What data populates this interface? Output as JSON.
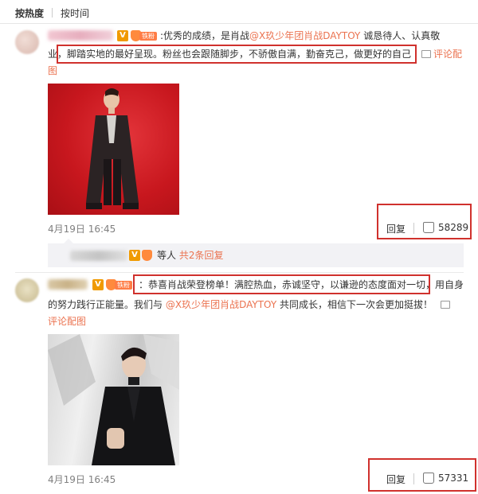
{
  "sort_tabs": {
    "active": "按热度",
    "other": "按时间"
  },
  "comment1": {
    "text_prefix": ":优秀的成绩，是肖战",
    "mention": "@X玖少年团肖战DAYTOY",
    "line1_suffix": "诚恳待人、认真敬",
    "line2_lead": "业",
    "line2_boxed": "，脚踏实地的最好呈现。粉丝也会跟随脚步，不骄傲自满，勤奋克己，做更好的自己",
    "pic_link_a": "评论配",
    "pic_link_b": "图",
    "time": "4月19日 16:45",
    "reply_label": "回复",
    "likes": "58289"
  },
  "sub_reply": {
    "suffix": "等人",
    "link": "共2条回复"
  },
  "comment2": {
    "line1_boxed": "：恭喜肖战荣登榜单！满腔热血，赤诚坚守，以谦逊的态度面对一切",
    "line1_suffix": "，用自身",
    "line2_prefix": "的努力践行正能量。我们与",
    "mention": "@X玖少年团肖战DAYTOY",
    "line2_suffix": "共同成长，相信下一次会更加挺拔！",
    "pic_link": "评论配图",
    "time": "4月19日 16:45",
    "reply_label": "回复",
    "likes": "57331"
  },
  "badges": {
    "verified": "V",
    "fan_label": "铁粉"
  },
  "colors": {
    "accent": "#eb7350",
    "highlight_box": "#d0312d",
    "badge_v": "#f09a00"
  }
}
